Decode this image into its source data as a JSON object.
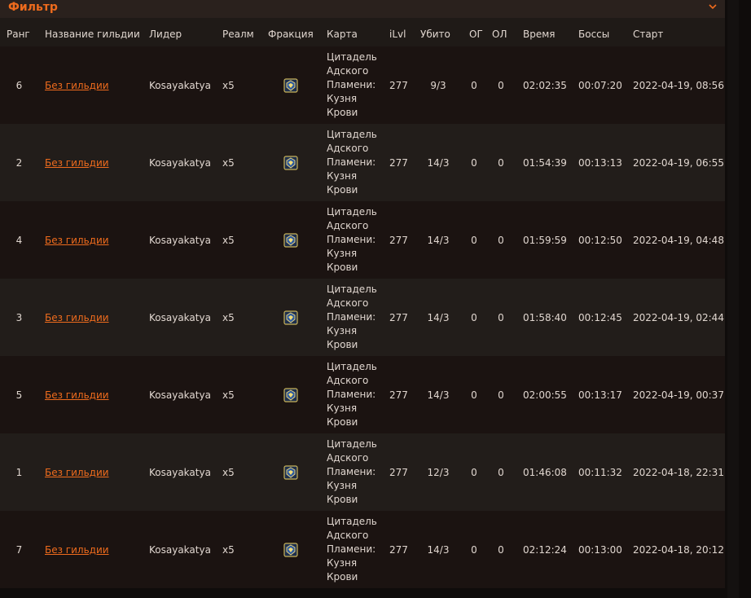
{
  "filter": {
    "label": "Фильтр",
    "icon": "chevron-down-icon"
  },
  "colors": {
    "accent": "#ee6b1d",
    "row_odd": "#1b1311",
    "row_even": "#221d1a"
  },
  "table": {
    "headers": {
      "rank": "Ранг",
      "guild": "Название гильдии",
      "leader": "Лидер",
      "realm": "Реалм",
      "faction": "Фракция",
      "map": "Карта",
      "ilvl": "iLvl",
      "killed": "Убито",
      "og": "ОГ",
      "ol": "ОЛ",
      "time": "Время",
      "bosses": "Боссы",
      "start": "Старт"
    },
    "rows": [
      {
        "rank": "6",
        "guild": "Без гильдии",
        "leader": "Kosayakatya",
        "realm": "x5",
        "faction": "alliance-icon",
        "map": [
          "Цитадель",
          "Адского",
          "Пламени:",
          "Кузня",
          "Крови"
        ],
        "ilvl": "277",
        "killed": "9/3",
        "og": "0",
        "ol": "0",
        "time": "02:02:35",
        "bosses": "00:07:20",
        "start": "2022-04-19, 08:56"
      },
      {
        "rank": "2",
        "guild": "Без гильдии",
        "leader": "Kosayakatya",
        "realm": "x5",
        "faction": "alliance-icon",
        "map": [
          "Цитадель",
          "Адского",
          "Пламени:",
          "Кузня",
          "Крови"
        ],
        "ilvl": "277",
        "killed": "14/3",
        "og": "0",
        "ol": "0",
        "time": "01:54:39",
        "bosses": "00:13:13",
        "start": "2022-04-19, 06:55"
      },
      {
        "rank": "4",
        "guild": "Без гильдии",
        "leader": "Kosayakatya",
        "realm": "x5",
        "faction": "alliance-icon",
        "map": [
          "Цитадель",
          "Адского",
          "Пламени:",
          "Кузня",
          "Крови"
        ],
        "ilvl": "277",
        "killed": "14/3",
        "og": "0",
        "ol": "0",
        "time": "01:59:59",
        "bosses": "00:12:50",
        "start": "2022-04-19, 04:48"
      },
      {
        "rank": "3",
        "guild": "Без гильдии",
        "leader": "Kosayakatya",
        "realm": "x5",
        "faction": "alliance-icon",
        "map": [
          "Цитадель",
          "Адского",
          "Пламени:",
          "Кузня",
          "Крови"
        ],
        "ilvl": "277",
        "killed": "14/3",
        "og": "0",
        "ol": "0",
        "time": "01:58:40",
        "bosses": "00:12:45",
        "start": "2022-04-19, 02:44"
      },
      {
        "rank": "5",
        "guild": "Без гильдии",
        "leader": "Kosayakatya",
        "realm": "x5",
        "faction": "alliance-icon",
        "map": [
          "Цитадель",
          "Адского",
          "Пламени:",
          "Кузня",
          "Крови"
        ],
        "ilvl": "277",
        "killed": "14/3",
        "og": "0",
        "ol": "0",
        "time": "02:00:55",
        "bosses": "00:13:17",
        "start": "2022-04-19, 00:37"
      },
      {
        "rank": "1",
        "guild": "Без гильдии",
        "leader": "Kosayakatya",
        "realm": "x5",
        "faction": "alliance-icon",
        "map": [
          "Цитадель",
          "Адского",
          "Пламени:",
          "Кузня",
          "Крови"
        ],
        "ilvl": "277",
        "killed": "12/3",
        "og": "0",
        "ol": "0",
        "time": "01:46:08",
        "bosses": "00:11:32",
        "start": "2022-04-18, 22:31"
      },
      {
        "rank": "7",
        "guild": "Без гильдии",
        "leader": "Kosayakatya",
        "realm": "x5",
        "faction": "alliance-icon",
        "map": [
          "Цитадель",
          "Адского",
          "Пламени:",
          "Кузня",
          "Крови"
        ],
        "ilvl": "277",
        "killed": "14/3",
        "og": "0",
        "ol": "0",
        "time": "02:12:24",
        "bosses": "00:13:00",
        "start": "2022-04-18, 20:12"
      }
    ]
  }
}
